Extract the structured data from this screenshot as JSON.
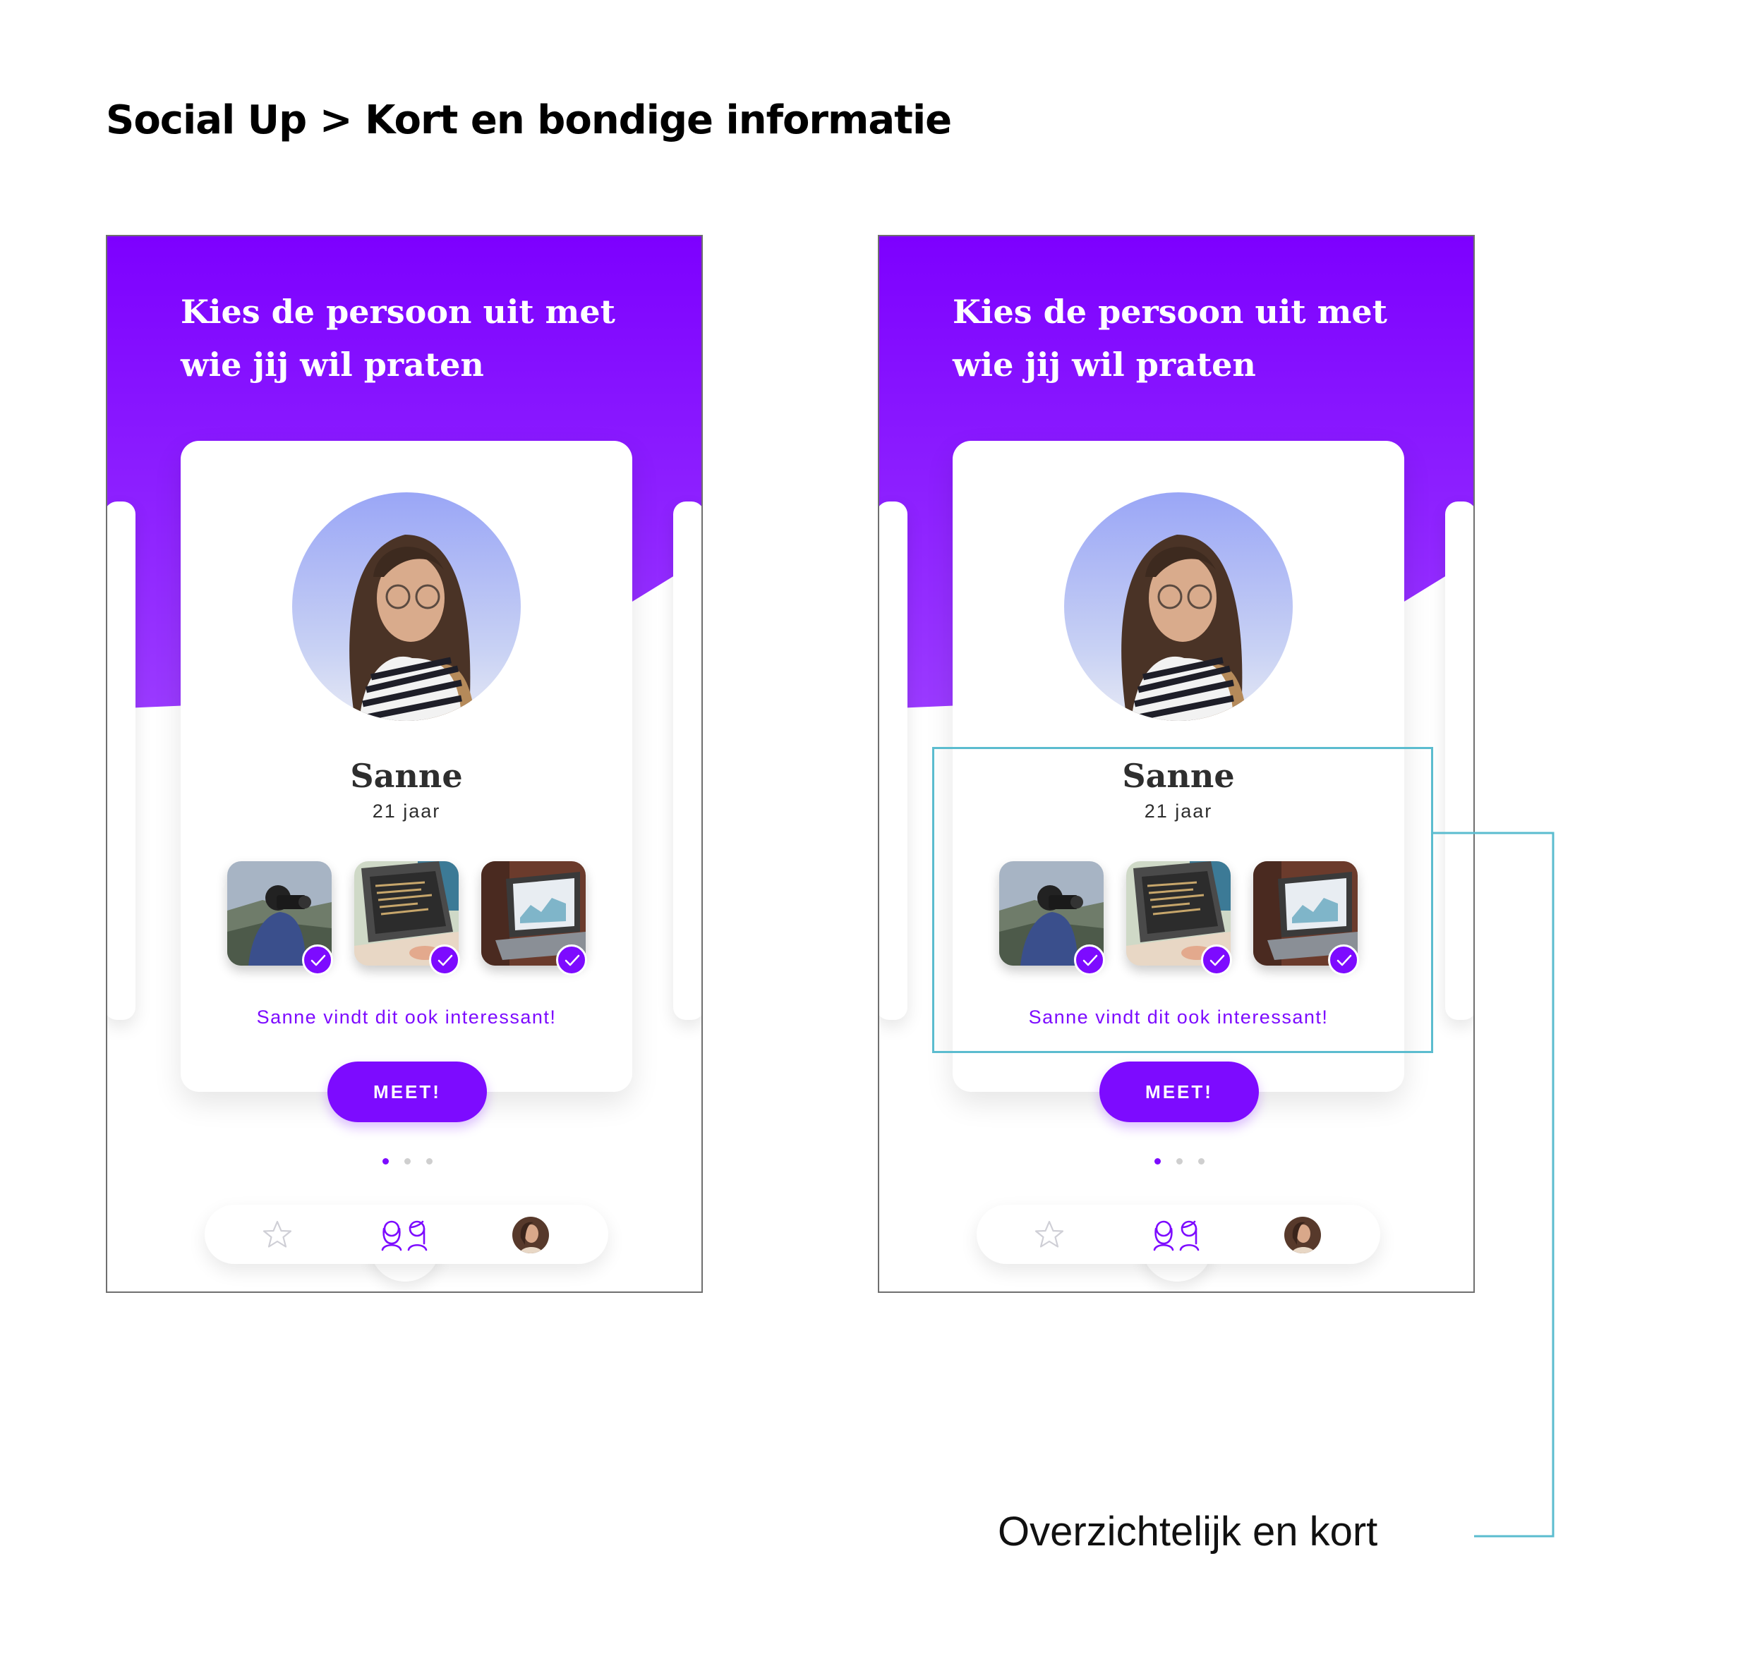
{
  "page": {
    "title": "Social Up > Kort en bondige informatie"
  },
  "screens": [
    {
      "heading_line1": "Kies de persoon uit met",
      "heading_line2": "wie jij wil praten",
      "person_name": "Sanne",
      "person_age": "21 jaar",
      "interests": [
        {
          "name": "fotografie",
          "checked": true
        },
        {
          "name": "programmeren",
          "checked": true
        },
        {
          "name": "data-analyse",
          "checked": true
        }
      ],
      "shared_interest_text": "Sanne vindt dit ook interessant!",
      "meet_button_label": "MEET!",
      "pagination": {
        "pages": 3,
        "active": 1
      },
      "tabbar": {
        "items": [
          "star-icon",
          "people-icon",
          "profile-avatar"
        ],
        "active": "people-icon"
      }
    },
    {
      "heading_line1": "Kies de persoon uit met",
      "heading_line2": "wie jij wil praten",
      "person_name": "Sanne",
      "person_age": "21 jaar",
      "interests": [
        {
          "name": "fotografie",
          "checked": true
        },
        {
          "name": "programmeren",
          "checked": true
        },
        {
          "name": "data-analyse",
          "checked": true
        }
      ],
      "shared_interest_text": "Sanne vindt dit ook interessant!",
      "meet_button_label": "MEET!",
      "pagination": {
        "pages": 3,
        "active": 1
      },
      "tabbar": {
        "items": [
          "star-icon",
          "people-icon",
          "profile-avatar"
        ],
        "active": "people-icon"
      }
    }
  ],
  "annotation": {
    "label": "Overzichtelijk en kort"
  },
  "colors": {
    "accent": "#7d0bff",
    "header_gradient_top": "#7d00ff",
    "header_gradient_bottom": "#9a3aff",
    "highlight": "#5bbccf",
    "inactive_dot": "#cfcfcf"
  }
}
